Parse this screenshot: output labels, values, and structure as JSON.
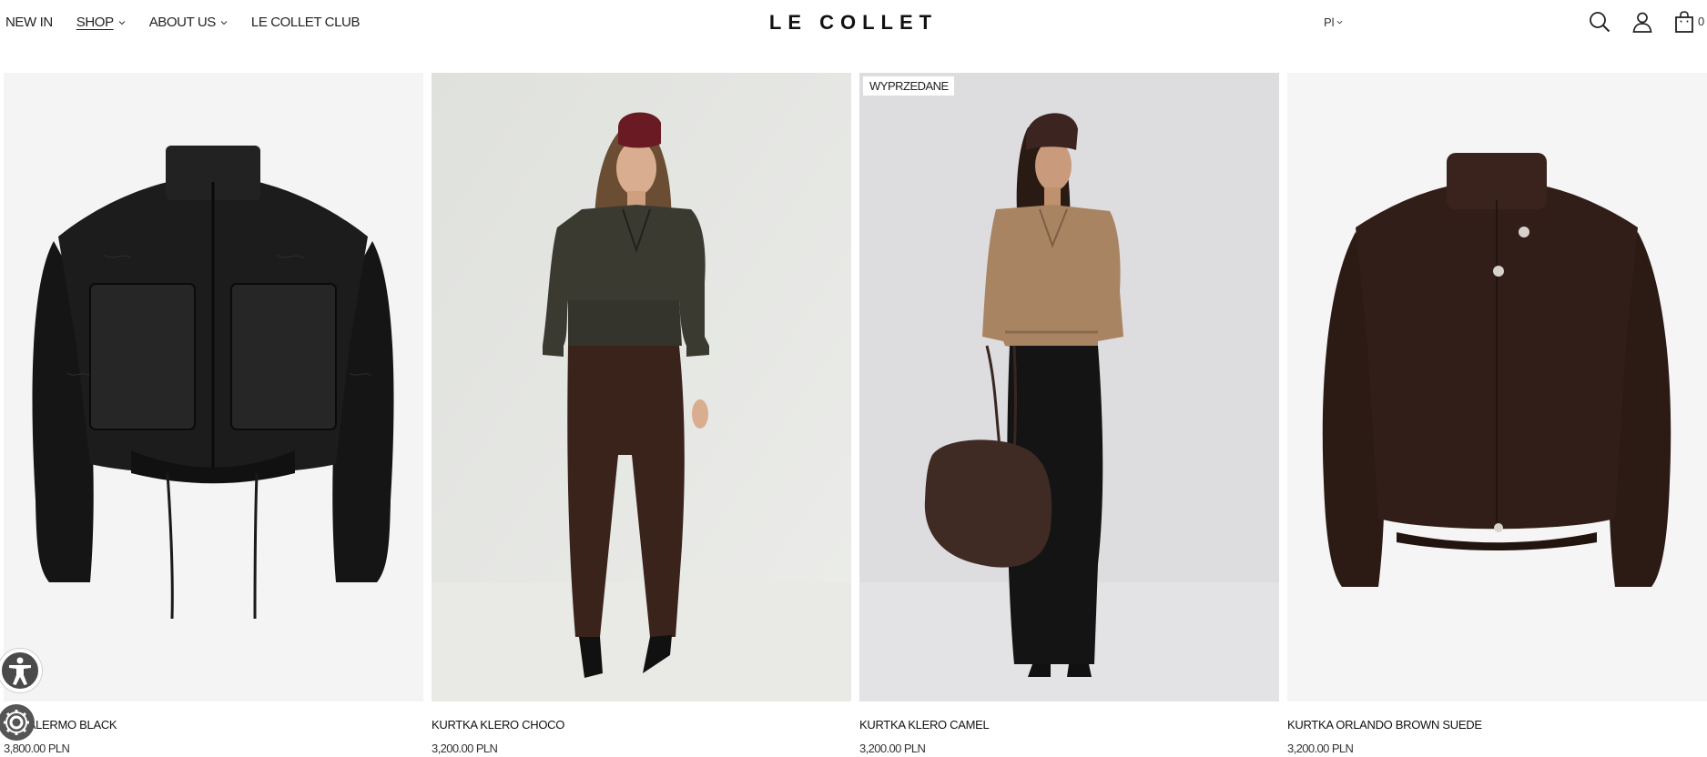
{
  "nav": {
    "items": [
      {
        "label": "NEW IN",
        "dropdown": false,
        "active": false
      },
      {
        "label": "SHOP",
        "dropdown": true,
        "active": true
      },
      {
        "label": "ABOUT US",
        "dropdown": true,
        "active": false
      },
      {
        "label": "LE COLLET CLUB",
        "dropdown": false,
        "active": false
      }
    ]
  },
  "brand": {
    "logo_text": "LE COLLET"
  },
  "language": {
    "current": "Pl"
  },
  "header_icons": {
    "search": "search-icon",
    "account": "user-icon",
    "cart": "bag-icon"
  },
  "cart": {
    "count": "0"
  },
  "products": [
    {
      "name": "KURTKA PALERMO BLACK",
      "visible_name": "KA PALERMO BLACK",
      "price": "3,800.00 PLN",
      "badge": "",
      "image": "black textured leather bomber jacket with drawstring hem"
    },
    {
      "name": "KURTKA KLERO CHOCO",
      "price": "3,200.00 PLN",
      "badge": "",
      "image": "model in dark olive leather jacket, burgundy hat, brown trousers"
    },
    {
      "name": "KURTKA KLERO CAMEL",
      "price": "3,200.00 PLN",
      "badge": "WYPRZEDANE",
      "image": "model in camel leather jacket, black maxi skirt, brown bag"
    },
    {
      "name": "KURTKA ORLANDO BROWN SUEDE",
      "price": "3,200.00 PLN",
      "badge": "",
      "image": "dark brown suede high-neck jacket"
    }
  ],
  "widgets": {
    "accessibility": "accessibility-icon",
    "settings": "gear-icon"
  },
  "colors": {
    "text": "#111111",
    "image_bg_light": "#f4f4f4",
    "image_bg_grey": "#e6e7e4",
    "badge_bg": "#ffffff"
  }
}
